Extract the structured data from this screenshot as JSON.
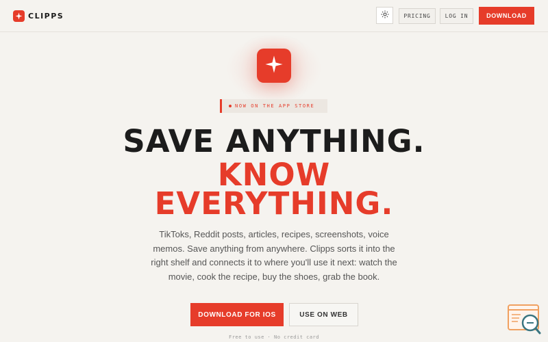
{
  "header": {
    "brand_name": "CLIPPS",
    "theme_icon": "sun-icon",
    "pricing_label": "PRICING",
    "login_label": "LOG IN",
    "download_label": "DOWNLOAD"
  },
  "hero": {
    "badge_text": "NOW ON THE APP STORE",
    "headline_line1": "SAVE ANYTHING.",
    "headline_line2": "KNOW",
    "headline_line3": "EVERYTHING.",
    "description": "TikToks, Reddit posts, articles, recipes, screenshots, voice memos. Save anything from anywhere. Clipps sorts it into the right shelf and connects it to where you'll use it next: watch the movie, cook the recipe, buy the shoes, grab the book.",
    "primary_cta": "DOWNLOAD FOR IOS",
    "secondary_cta": "USE ON WEB",
    "footnote": "Free to use · No credit card"
  },
  "colors": {
    "accent": "#e63c2a",
    "background": "#f5f3ef",
    "text": "#1a1a1a"
  }
}
